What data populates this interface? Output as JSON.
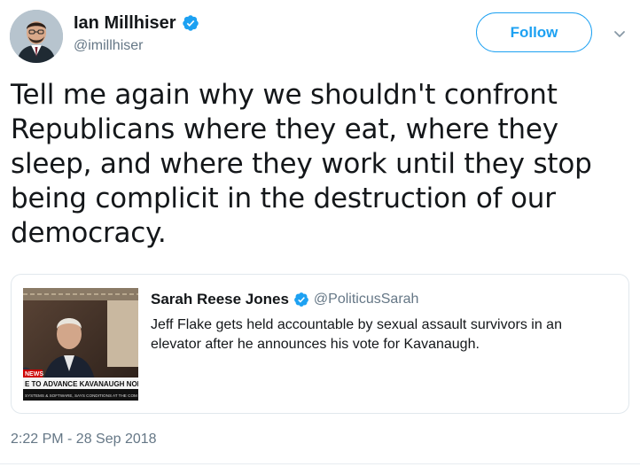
{
  "author": {
    "display_name": "Ian Millhiser",
    "handle": "@imillhiser",
    "verified": true
  },
  "follow_button": {
    "label": "Follow"
  },
  "tweet": {
    "text": "Tell me again why we shouldn't confront Republicans where they eat, where they sleep, and where they work until they stop being complicit in the destruction of our democracy.",
    "timestamp": "2:22 PM - 28 Sep 2018"
  },
  "quote": {
    "display_name": "Sarah Reese Jones",
    "handle": "@PoliticusSarah",
    "verified": true,
    "text": "Jeff Flake gets held accountable by sexual assault survivors in an elevator after he announces his vote for Kavanaugh.",
    "media": {
      "badge": "NEWS",
      "headline": "E TO ADVANCE KAVANAUGH NOMINATION",
      "ticker": "SYSTEMS & SOFTWARE, SAYS CONDITIONS AT THE COM"
    }
  },
  "colors": {
    "accent": "#1da1f2",
    "text": "#14171a",
    "secondary": "#657786",
    "border": "#e1e8ed"
  },
  "icons": {
    "verified": "verified-badge-icon",
    "caret": "chevron-down-icon"
  }
}
